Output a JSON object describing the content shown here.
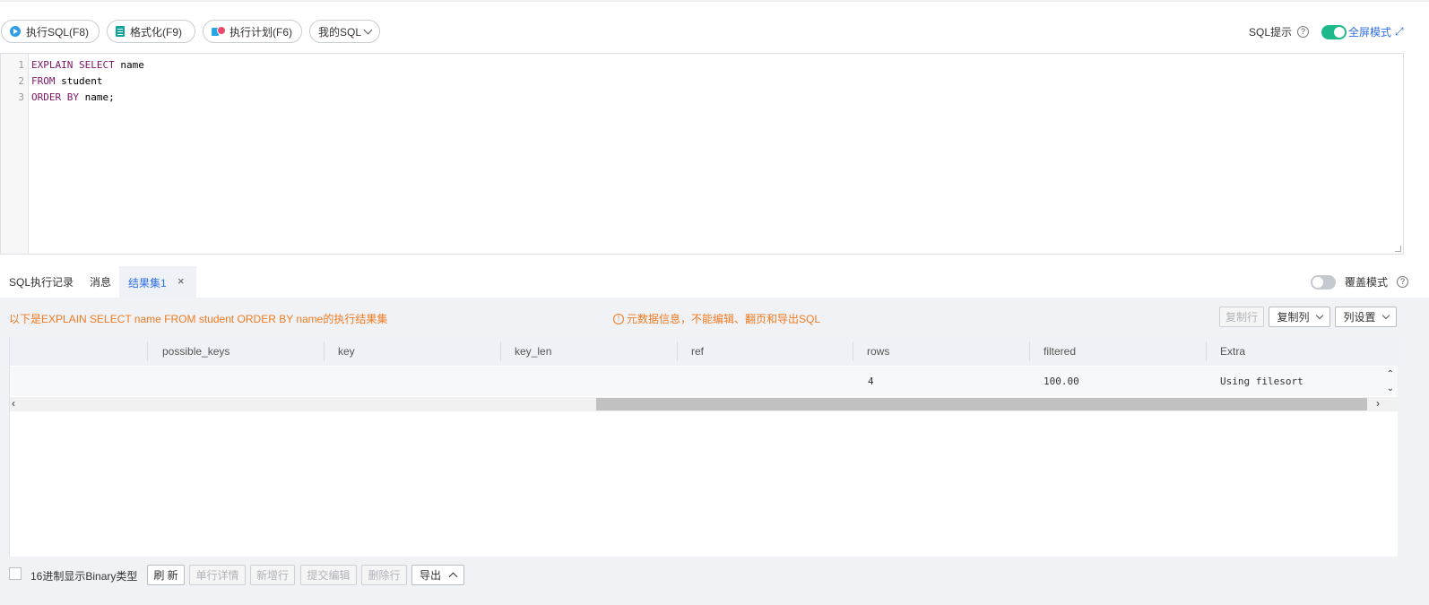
{
  "toolbar": {
    "run_sql": "执行SQL(F8)",
    "format": "格式化(F9)",
    "exec_plan": "执行计划(F6)",
    "my_sql": "我的SQL",
    "sql_hint": "SQL提示",
    "sql_hint_enabled": true,
    "fullscreen": "全屏模式"
  },
  "editor": {
    "lines": [
      {
        "num": "1",
        "kw1": "EXPLAIN SELECT",
        "rest1": " name"
      },
      {
        "num": "2",
        "kw1": "FROM",
        "rest1": " student"
      },
      {
        "num": "3",
        "kw1": "ORDER BY",
        "rest1": " name;"
      }
    ]
  },
  "tabs": {
    "history": "SQL执行记录",
    "messages": "消息",
    "result": "结果集1",
    "overwrite_mode": "覆盖模式",
    "overwrite_enabled": false
  },
  "result": {
    "info": "以下是EXPLAIN SELECT name FROM student ORDER BY name的执行结果集",
    "meta_notice": "元数据信息，不能编辑、翻页和导出SQL",
    "copy_row": "复制行",
    "copy_col": "复制列",
    "col_settings": "列设置",
    "columns": [
      "possible_keys",
      "key",
      "key_len",
      "ref",
      "rows",
      "filtered",
      "Extra"
    ],
    "rows": [
      {
        "possible_keys": "",
        "key": "",
        "key_len": "",
        "ref": "",
        "rows": "4",
        "filtered": "100.00",
        "Extra": "Using filesort"
      }
    ]
  },
  "footer": {
    "hex_binary": "16进制显示Binary类型",
    "refresh": "刷 新",
    "row_detail": "单行详情",
    "add_row": "新增行",
    "submit_edit": "提交编辑",
    "delete_row": "删除行",
    "export": "导出"
  },
  "colors": {
    "accent": "#2f6fe6",
    "toggle_on": "#1fb88a",
    "warning": "#f07a20"
  }
}
